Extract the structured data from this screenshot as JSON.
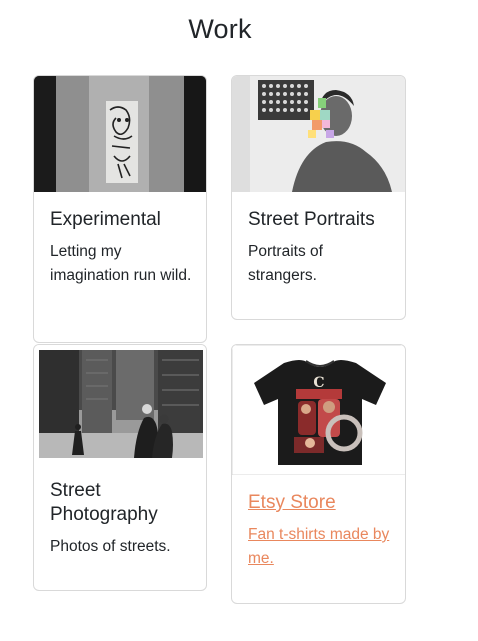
{
  "header": {
    "title": "Work"
  },
  "cards": [
    {
      "title": "Experimental",
      "text": "Letting my imagination run wild.",
      "image": "graffiti-sticker-photo"
    },
    {
      "title": "Street Portraits",
      "text": "Portraits of strangers.",
      "image": "portrait-photo"
    },
    {
      "title": "Street Photography",
      "text": "Photos of streets.",
      "image": "street-scene-photo"
    },
    {
      "title": "Etsy Store",
      "text": "Fan t-shirts made by me.",
      "image": "tshirt-photo",
      "link_color": "#e9875d"
    }
  ]
}
